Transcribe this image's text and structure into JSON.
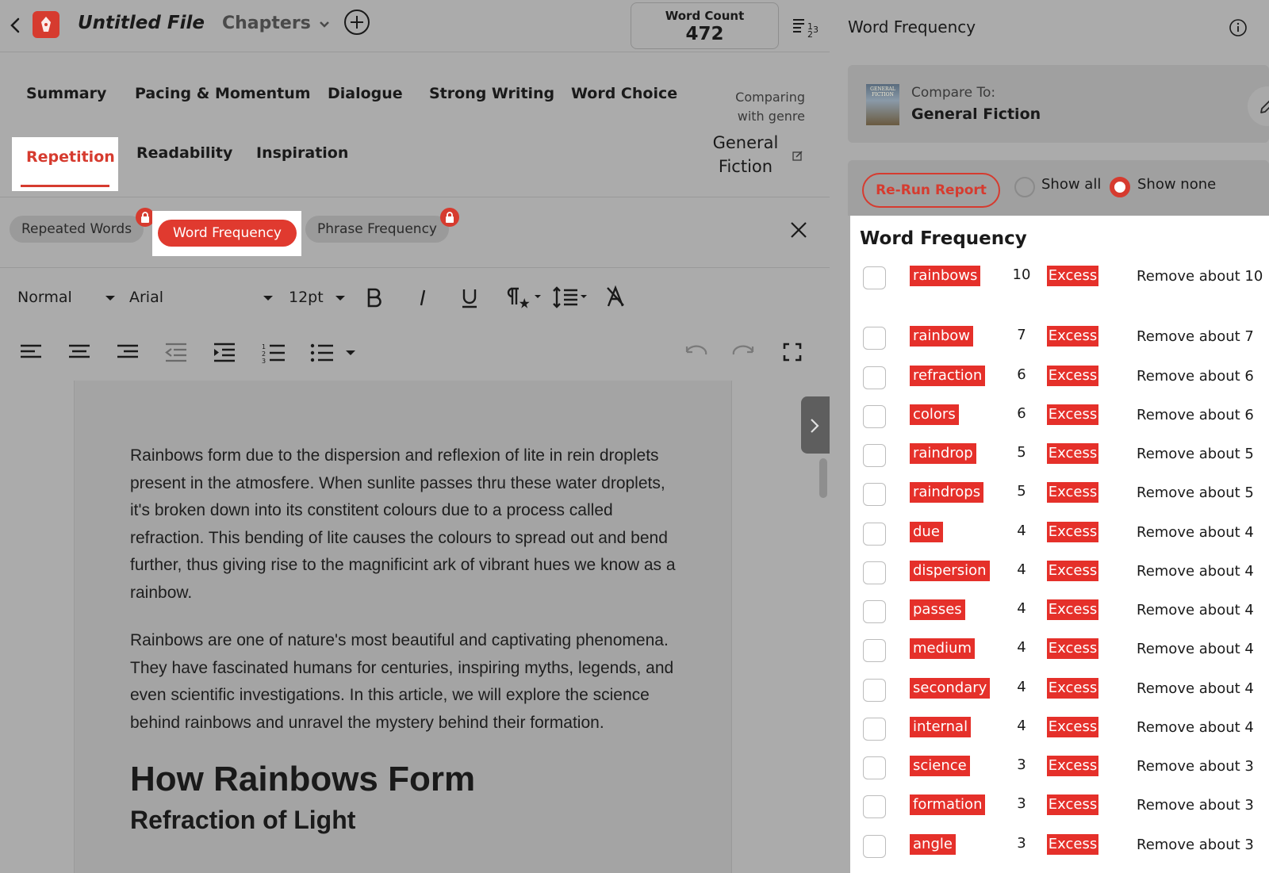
{
  "header": {
    "file_title": "Untitled File",
    "chapters_label": "Chapters",
    "word_count_label": "Word Count",
    "word_count_value": "472"
  },
  "report_tabs": {
    "row1": [
      "Summary",
      "Pacing & Momentum",
      "Dialogue",
      "Strong Writing",
      "Word Choice"
    ],
    "active": "Repetition",
    "row2": [
      "Readability",
      "Inspiration"
    ]
  },
  "genre": {
    "line1": "Comparing",
    "line2": "with genre",
    "name_line1": "General",
    "name_line2": "Fiction"
  },
  "subtabs": {
    "repeated_words": "Repeated Words",
    "word_frequency": "Word Frequency",
    "phrase_frequency": "Phrase Frequency"
  },
  "toolbar": {
    "style": "Normal",
    "font": "Arial",
    "size": "12pt"
  },
  "editor": {
    "paragraphs": [
      "Rainbows form due to the dispersion and reflexion of lite in rein droplets present in the atmosfere. When sunlite passes thru these water droplets, it's broken down into its constitent colours due to a process called refraction. This bending of lite causes the colours to spread out and bend further, thus giving rise to the magnificint ark of vibrant hues we know as a rainbow.",
      "Rainbows are one of nature's most beautiful and captivating phenomena. They have fascinated humans for centuries, inspiring myths, legends, and even scientific investigations. In this article, we will explore the science behind rainbows and unravel the mystery behind their formation."
    ],
    "heading1": "How Rainbows Form",
    "heading2": "Refraction of Light"
  },
  "panel": {
    "title": "Word Frequency",
    "compare_label": "Compare To:",
    "compare_value": "General Fiction",
    "book_cover_text": "GENERAL FICTION",
    "rerun_label": "Re-Run Report",
    "show_all_label": "Show all",
    "show_none_label": "Show none",
    "selected_filter": "Show none",
    "list_heading": "Word Frequency"
  },
  "word_frequency": [
    {
      "word": "rainbows",
      "count": "10",
      "status": "Excess",
      "action": "Remove about 10"
    },
    {
      "word": "rainbow",
      "count": "7",
      "status": "Excess",
      "action": "Remove about 7"
    },
    {
      "word": "refraction",
      "count": "6",
      "status": "Excess",
      "action": "Remove about 6"
    },
    {
      "word": "colors",
      "count": "6",
      "status": "Excess",
      "action": "Remove about 6"
    },
    {
      "word": "raindrop",
      "count": "5",
      "status": "Excess",
      "action": "Remove about 5"
    },
    {
      "word": "raindrops",
      "count": "5",
      "status": "Excess",
      "action": "Remove about 5"
    },
    {
      "word": "due",
      "count": "4",
      "status": "Excess",
      "action": "Remove about 4"
    },
    {
      "word": "dispersion",
      "count": "4",
      "status": "Excess",
      "action": "Remove about 4"
    },
    {
      "word": "passes",
      "count": "4",
      "status": "Excess",
      "action": "Remove about 4"
    },
    {
      "word": "medium",
      "count": "4",
      "status": "Excess",
      "action": "Remove about 4"
    },
    {
      "word": "secondary",
      "count": "4",
      "status": "Excess",
      "action": "Remove about 4"
    },
    {
      "word": "internal",
      "count": "4",
      "status": "Excess",
      "action": "Remove about 4"
    },
    {
      "word": "science",
      "count": "3",
      "status": "Excess",
      "action": "Remove about 3"
    },
    {
      "word": "formation",
      "count": "3",
      "status": "Excess",
      "action": "Remove about 3"
    },
    {
      "word": "angle",
      "count": "3",
      "status": "Excess",
      "action": "Remove about 3"
    }
  ],
  "colors": {
    "accent": "#e5302a",
    "dim_overlay": "#ababab"
  }
}
